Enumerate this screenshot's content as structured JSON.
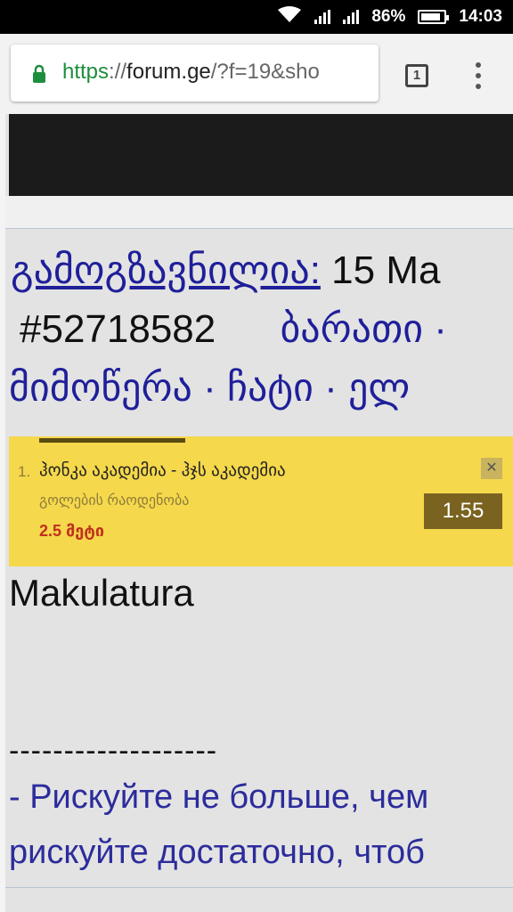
{
  "status_bar": {
    "battery": "86%",
    "time": "14:03",
    "battery_level": 0.86
  },
  "browser": {
    "url_scheme": "https",
    "url_sep": "://",
    "url_host": "forum.ge",
    "url_path": "/?f=19&sho",
    "tab_count": "1"
  },
  "post": {
    "sent_label": "გამოგზავნილია:",
    "date_fragment": "15 Ma",
    "post_number": "#52718582",
    "link_barati": "ბარათი ·",
    "link_correspondence": "მიმოწერა",
    "link_chat": "ჩატი",
    "link_email": "ელ",
    "separator": "·",
    "body": "Makulatura",
    "signature_divider": "-------------------",
    "signature_line1": "- Рискуйте не больше, чем",
    "signature_line2": "рискуйте достаточно, чтоб"
  },
  "ad": {
    "index": "1.",
    "match": "ჰონკა აკადემია - ჰჯს აკადემია",
    "market": "გოლების რაოდენობა",
    "selection": "2.5 მეტი",
    "odds": "1.55",
    "close_symbol": "✕"
  }
}
